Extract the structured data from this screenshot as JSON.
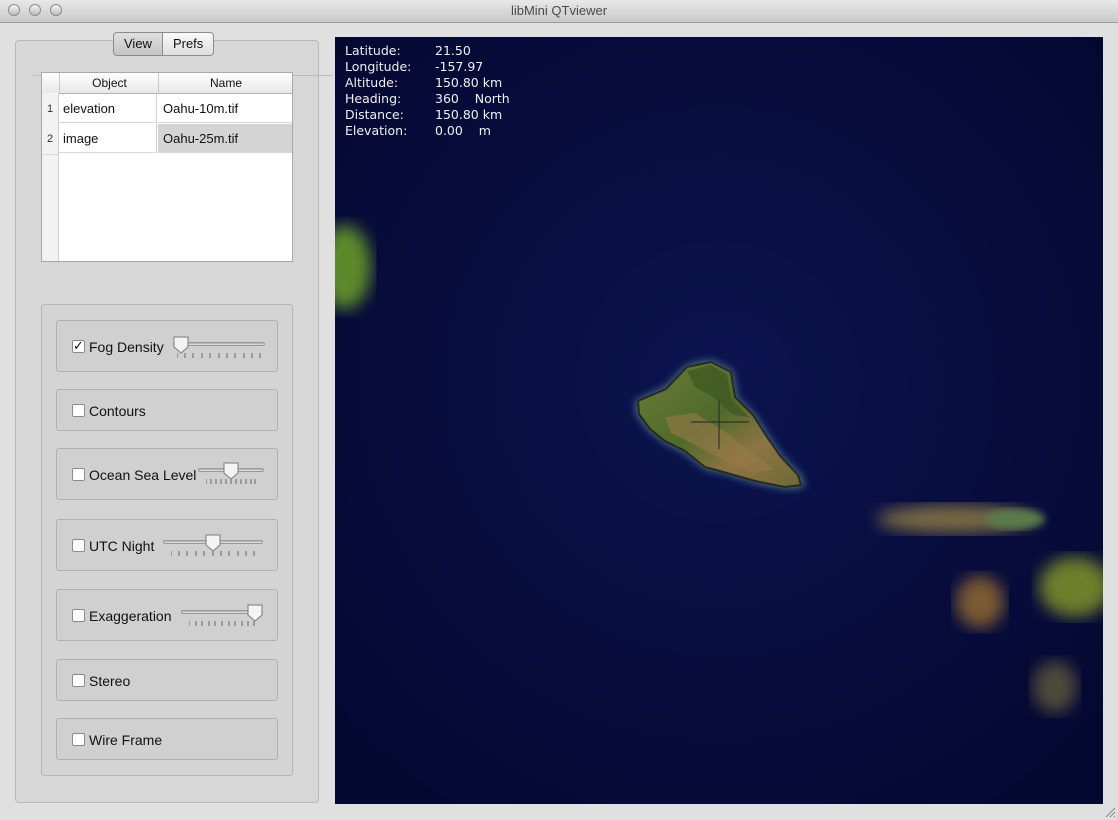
{
  "window": {
    "title": "libMini QTviewer"
  },
  "tabs": [
    {
      "label": "View",
      "selected": true
    },
    {
      "label": "Prefs",
      "selected": false
    }
  ],
  "table": {
    "columns": [
      "Object",
      "Name"
    ],
    "rows": [
      {
        "num": "1",
        "object": "elevation",
        "name": "Oahu-10m.tif"
      },
      {
        "num": "2",
        "object": "image",
        "name": "Oahu-25m.tif"
      }
    ]
  },
  "controls": {
    "fog": {
      "label": "Fog Density",
      "checked": true,
      "level": 0.0
    },
    "contours": {
      "label": "Contours",
      "checked": false
    },
    "sealevel": {
      "label": "Ocean Sea Level",
      "checked": false,
      "level": 0.5
    },
    "utc": {
      "label": "UTC Night",
      "checked": false,
      "level": 0.5
    },
    "exaggeration": {
      "label": "Exaggeration",
      "checked": false,
      "level": 1.0
    },
    "stereo": {
      "label": "Stereo",
      "checked": false
    },
    "wireframe": {
      "label": "Wire Frame",
      "checked": false
    }
  },
  "hud": {
    "latitude_label": "Latitude:",
    "latitude_value": "21.50",
    "longitude_label": "Longitude:",
    "longitude_value": "-157.97",
    "altitude_label": "Altitude:",
    "altitude_value": "150.80 km",
    "heading_label": "Heading:",
    "heading_value": "360    North",
    "distance_label": "Distance:",
    "distance_value": "150.80 km",
    "elevation_label": "Elevation:",
    "elevation_value": "0.00    m"
  },
  "colors": {
    "ocean": "#05083a",
    "land_green": "#5d7a2e",
    "land_brown": "#8a6a3a",
    "reef": "#7fc8c0"
  },
  "icons": {
    "checkmark": "check-icon",
    "crosshair": "crosshair-icon"
  }
}
